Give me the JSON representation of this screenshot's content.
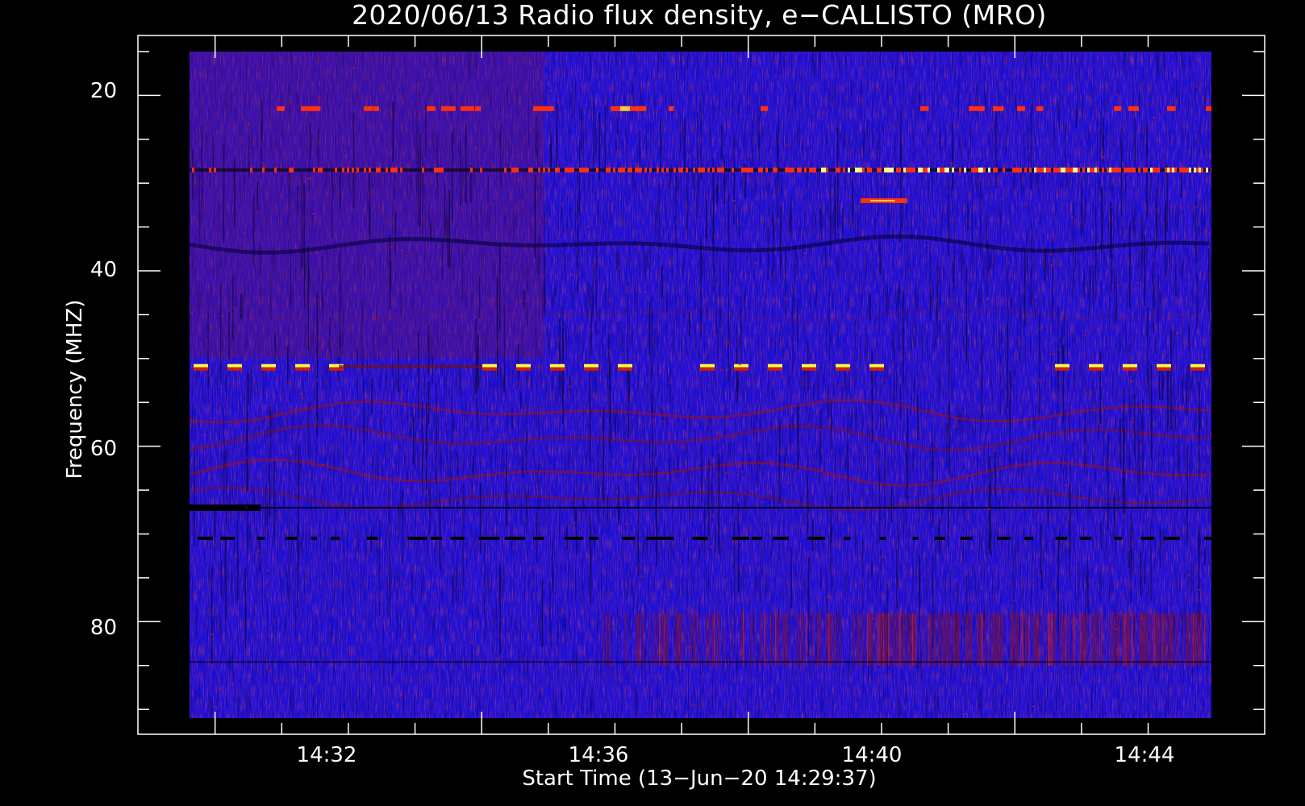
{
  "chart_data": {
    "type": "heatmap",
    "title": "2020/06/13  Radio flux density, e−CALLISTO (MRO)",
    "xlabel": "Start Time (13−Jun−20 14:29:37)",
    "ylabel": "Frequency (MHZ)",
    "x_range": [
      "14:29:37",
      "14:44:57"
    ],
    "y_range_mhz": [
      15,
      91
    ],
    "y_inverted": true,
    "x_tick_labels": [
      "14:32",
      "14:36",
      "14:40",
      "14:44"
    ],
    "y_tick_labels": [
      "20",
      "40",
      "60",
      "80"
    ],
    "colormap": {
      "background": "#000000",
      "low": "#1f10d8",
      "mid": "#8b1010",
      "high": "#ff2000",
      "peak": "#ffff40"
    },
    "features": [
      {
        "kind": "interference-dashes",
        "frequency_mhz": 51,
        "color": "#ffff40"
      },
      {
        "kind": "interference-band",
        "frequency_mhz": 28.5,
        "color": "#ff3010"
      },
      {
        "kind": "interference-band",
        "frequency_mhz": 21.5,
        "color": "#ff3010"
      },
      {
        "kind": "dark-band",
        "frequency_mhz": 67,
        "color": "#000000"
      },
      {
        "kind": "dark-band",
        "frequency_mhz": 70.5,
        "color": "#000000"
      },
      {
        "kind": "emission-patch",
        "frequency_mhz": 32,
        "color": "#ff3010"
      },
      {
        "kind": "broadband-emission",
        "frequency_range_mhz": [
          79,
          85
        ],
        "color": "#8b1010"
      }
    ],
    "grid": false,
    "legend": "none"
  }
}
